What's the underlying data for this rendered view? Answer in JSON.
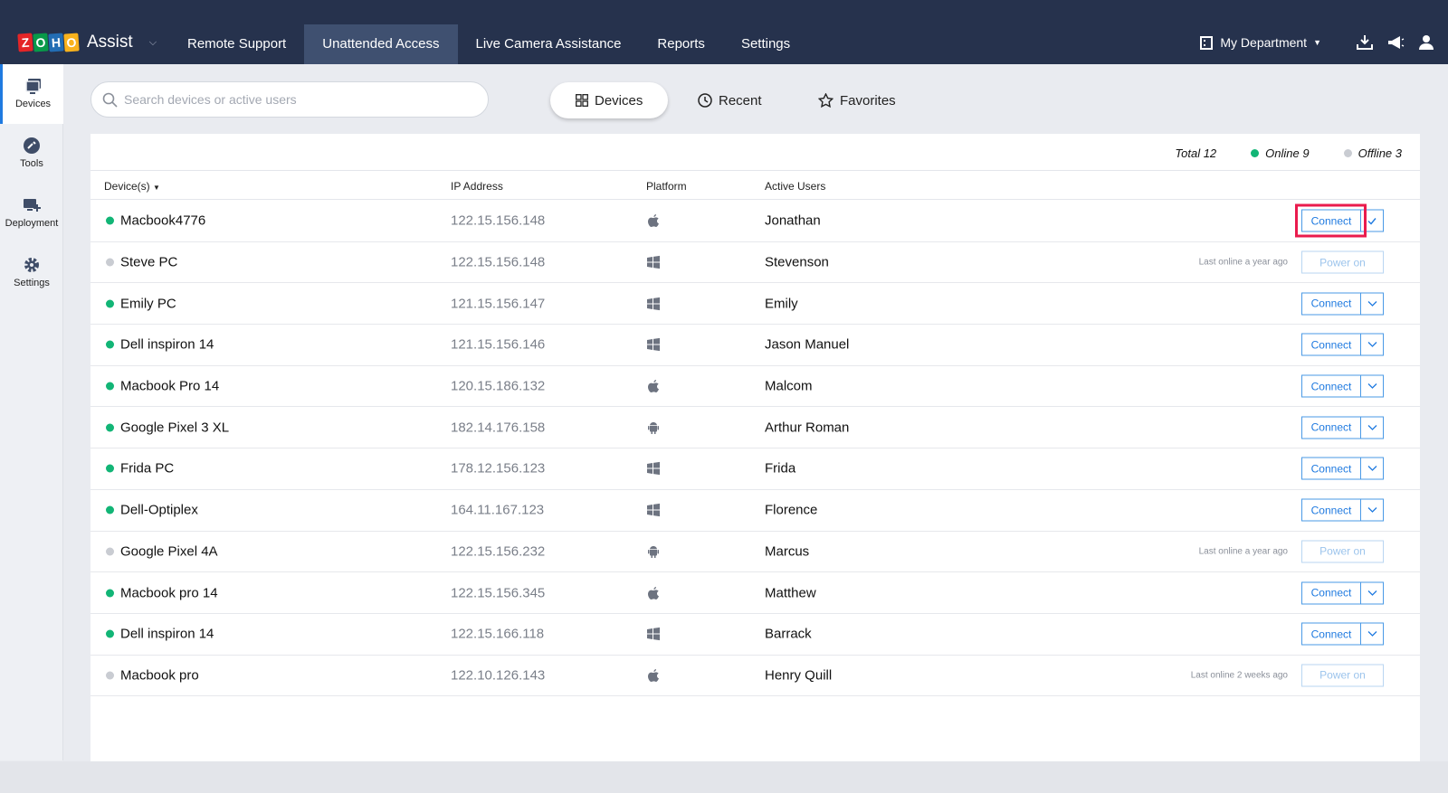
{
  "app": {
    "logo_letters": [
      {
        "ch": "Z",
        "color": "#e42527"
      },
      {
        "ch": "O",
        "color": "#089949"
      },
      {
        "ch": "H",
        "color": "#226db4"
      },
      {
        "ch": "O",
        "color": "#f9b21d"
      }
    ],
    "product": "Assist"
  },
  "nav": {
    "tabs": [
      {
        "label": "Remote Support",
        "active": false
      },
      {
        "label": "Unattended Access",
        "active": true
      },
      {
        "label": "Live Camera Assistance",
        "active": false
      },
      {
        "label": "Reports",
        "active": false
      },
      {
        "label": "Settings",
        "active": false
      }
    ],
    "department": "My Department"
  },
  "sidebar": {
    "items": [
      {
        "label": "Devices",
        "icon": "devices-icon",
        "active": true
      },
      {
        "label": "Tools",
        "icon": "tools-icon",
        "active": false
      },
      {
        "label": "Deployment",
        "icon": "deployment-icon",
        "active": false
      },
      {
        "label": "Settings",
        "icon": "settings-icon",
        "active": false
      }
    ]
  },
  "search": {
    "placeholder": "Search devices or active users",
    "value": ""
  },
  "view_tabs": {
    "devices": "Devices",
    "recent": "Recent",
    "favorites": "Favorites"
  },
  "totals": {
    "total": "Total 12",
    "online": "Online 9",
    "offline": "Offline 3"
  },
  "table": {
    "headers": {
      "device": "Device(s)",
      "ip": "IP Address",
      "platform": "Platform",
      "users": "Active Users"
    },
    "rows": [
      {
        "device": "Macbook4776",
        "ip": "122.15.156.148",
        "platform": "mac",
        "user": "Jonathan",
        "online": true,
        "last_online": ""
      },
      {
        "device": "Steve PC",
        "ip": "122.15.156.148",
        "platform": "windows",
        "user": "Stevenson",
        "online": false,
        "last_online": "Last online a year ago"
      },
      {
        "device": "Emily PC",
        "ip": "121.15.156.147",
        "platform": "windows",
        "user": "Emily",
        "online": true,
        "last_online": ""
      },
      {
        "device": "Dell inspiron 14",
        "ip": "121.15.156.146",
        "platform": "windows",
        "user": "Jason Manuel",
        "online": true,
        "last_online": ""
      },
      {
        "device": "Macbook Pro 14",
        "ip": "120.15.186.132",
        "platform": "mac",
        "user": "Malcom",
        "online": true,
        "last_online": ""
      },
      {
        "device": "Google Pixel 3 XL",
        "ip": "182.14.176.158",
        "platform": "android",
        "user": "Arthur Roman",
        "online": true,
        "last_online": ""
      },
      {
        "device": "Frida PC",
        "ip": "178.12.156.123",
        "platform": "windows",
        "user": "Frida",
        "online": true,
        "last_online": ""
      },
      {
        "device": "Dell-Optiplex",
        "ip": "164.11.167.123",
        "platform": "windows",
        "user": "Florence",
        "online": true,
        "last_online": ""
      },
      {
        "device": "Google Pixel 4A",
        "ip": "122.15.156.232",
        "platform": "android",
        "user": "Marcus",
        "online": false,
        "last_online": "Last online a year ago"
      },
      {
        "device": "Macbook pro 14",
        "ip": "122.15.156.345",
        "platform": "mac",
        "user": "Matthew",
        "online": true,
        "last_online": ""
      },
      {
        "device": "Dell inspiron 14",
        "ip": "122.15.166.118",
        "platform": "windows",
        "user": "Barrack",
        "online": true,
        "last_online": ""
      },
      {
        "device": "Macbook pro",
        "ip": "122.10.126.143",
        "platform": "mac",
        "user": "Henry Quill",
        "online": false,
        "last_online": "Last online 2 weeks ago"
      }
    ]
  },
  "buttons": {
    "connect": "Connect",
    "power_on": "Power on"
  },
  "colors": {
    "online": "#12b576",
    "offline": "#c9ccd2",
    "accent": "#1f7ae0",
    "highlight": "#ea1b4d",
    "topbar": "#26324d"
  }
}
